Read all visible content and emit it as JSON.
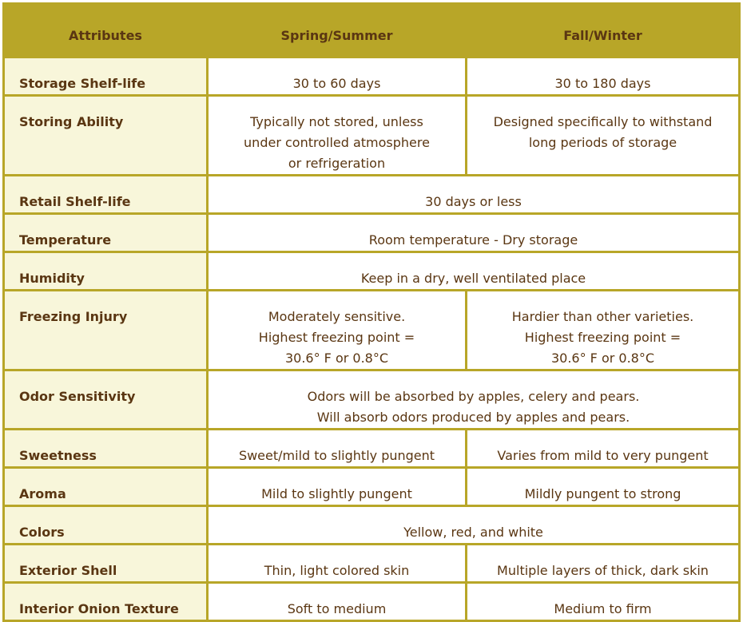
{
  "headers": [
    "Attributes",
    "Spring/Summer",
    "Fall/Winter"
  ],
  "rows": [
    {
      "attribute": "Storage Shelf-life",
      "spring_summer": "30 to 60 days",
      "fall_winter": "30 to 180 days"
    },
    {
      "attribute": "Storing Ability",
      "spring_summer": [
        "Typically not stored, unless",
        "under controlled atmosphere",
        "or refrigeration"
      ],
      "fall_winter": [
        "Designed specifically to withstand",
        "long periods of storage"
      ]
    },
    {
      "attribute": "Retail Shelf-life",
      "both": "30 days or less"
    },
    {
      "attribute": "Temperature",
      "both": "Room temperature - Dry storage"
    },
    {
      "attribute": "Humidity",
      "both": "Keep in a dry, well ventilated place"
    },
    {
      "attribute": "Freezing Injury",
      "spring_summer": [
        "Moderately sensitive.",
        "Highest freezing point =",
        "30.6° F or 0.8°C"
      ],
      "fall_winter": [
        "Hardier than other varieties.",
        "Highest freezing point =",
        "30.6° F or 0.8°C"
      ]
    },
    {
      "attribute": "Odor Sensitivity",
      "both": [
        "Odors will be absorbed by apples, celery and pears.",
        "Will absorb odors produced by apples and pears."
      ]
    },
    {
      "attribute": "Sweetness",
      "spring_summer": "Sweet/mild to slightly pungent",
      "fall_winter": "Varies from mild to very pungent"
    },
    {
      "attribute": "Aroma",
      "spring_summer": "Mild to slightly pungent",
      "fall_winter": "Mildly pungent to strong"
    },
    {
      "attribute": "Colors",
      "both": "Yellow, red, and white"
    },
    {
      "attribute": "Exterior Shell",
      "spring_summer": "Thin, light colored skin",
      "fall_winter": "Multiple layers of thick, dark skin"
    },
    {
      "attribute": "Interior Onion Texture",
      "spring_summer": "Soft to medium",
      "fall_winter": "Medium to firm"
    }
  ],
  "colors": {
    "border": "#b8a628",
    "attr_bg": "#f8f6da",
    "text": "#5a3612"
  }
}
